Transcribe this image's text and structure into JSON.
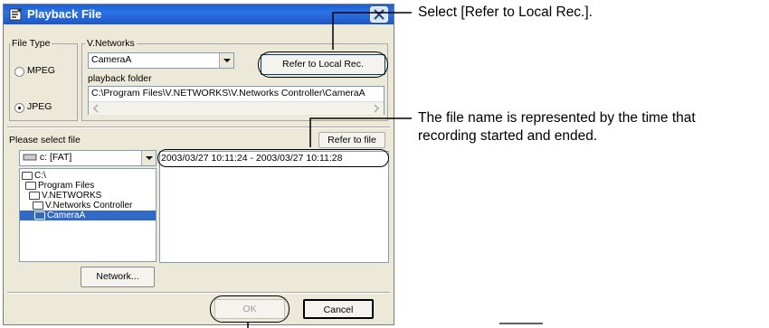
{
  "dialog": {
    "title": "Playback File",
    "file_type_label": "File Type",
    "mpeg_label": "MPEG",
    "jpeg_label": "JPEG",
    "vnetworks_label": "V.Networks",
    "camera_value": "CameraA",
    "refer_local_label": "Refer to Local Rec.",
    "playback_folder_label": "playback folder",
    "folder_path": "C:\\Program Files\\V.NETWORKS\\V.Networks Controller\\CameraA",
    "please_select_label": "Please select file",
    "refer_file_label": "Refer to file",
    "drive_value": "c: [FAT]",
    "file_entry": "2003/03/27 10:11:24 - 2003/03/27 10:11:28",
    "tree": [
      "C:\\",
      "Program Files",
      "V.NETWORKS",
      "V.Networks Controller",
      "CameraA"
    ],
    "network_label": "Network...",
    "ok_label": "OK",
    "cancel_label": "Cancel"
  },
  "annotations": {
    "refer_local_note": "Select [Refer to Local Rec.].",
    "filename_note_line1": "The file name is represented by the time that",
    "filename_note_line2": "recording started and ended."
  },
  "colors": {
    "titlebar": "#2c72e6",
    "dialog_bg": "#ece9d8",
    "selected": "#316ac5"
  }
}
